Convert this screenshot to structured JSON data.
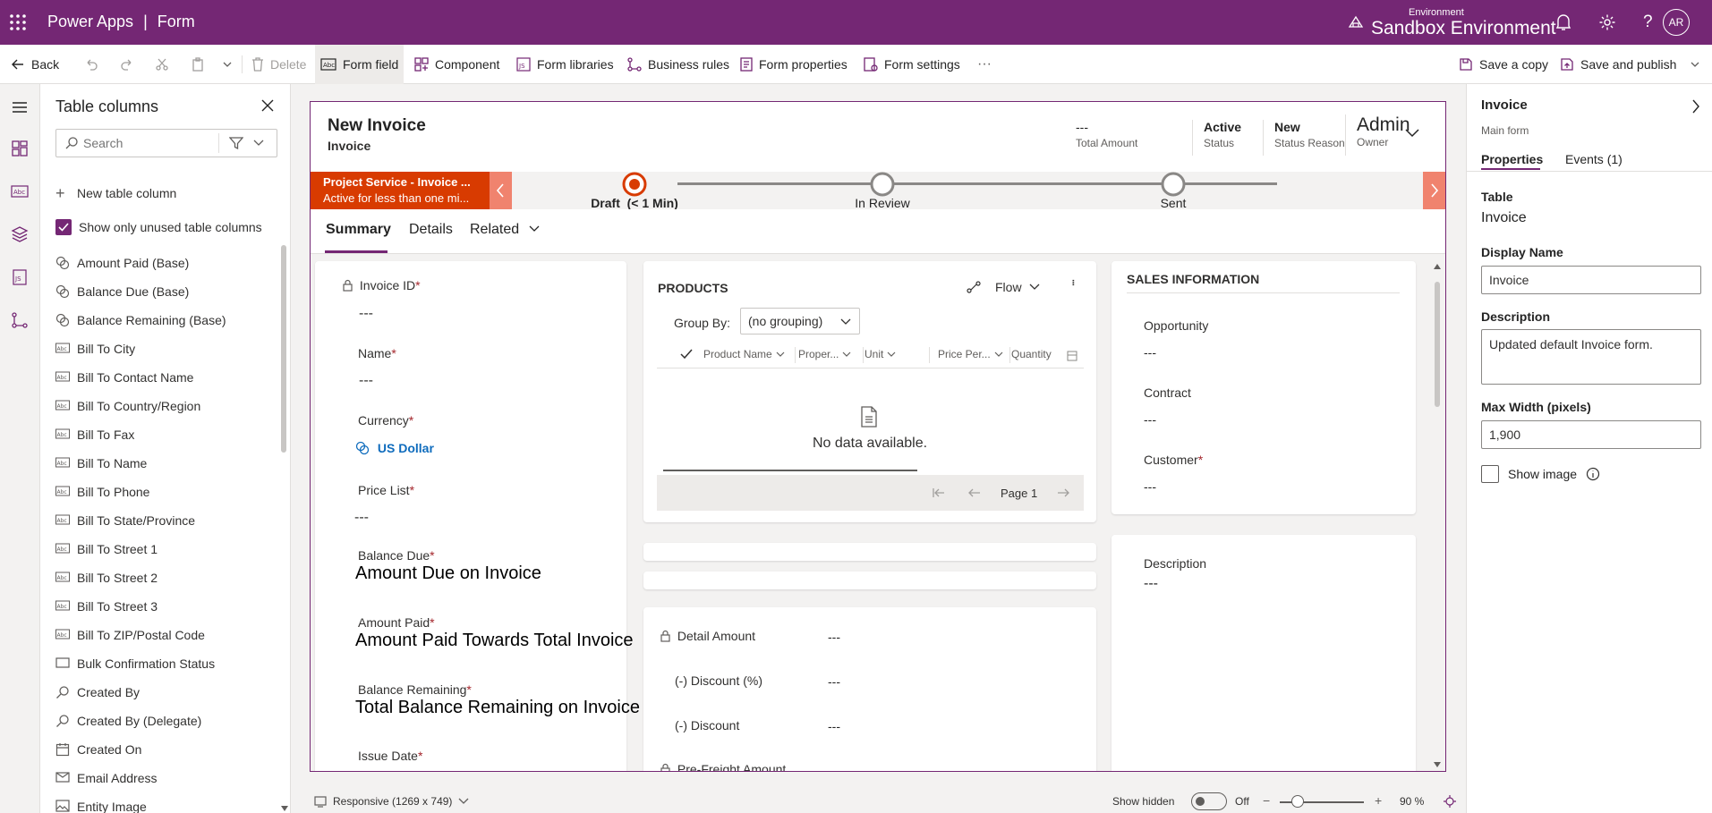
{
  "topbar": {
    "app": "Power Apps",
    "separator": "|",
    "section": "Form",
    "env_label": "Environment",
    "env_name": "Sandbox Environment",
    "avatar": "AR"
  },
  "commands": {
    "back": "Back",
    "delete": "Delete",
    "form_field": "Form field",
    "component": "Component",
    "form_libraries": "Form libraries",
    "business_rules": "Business rules",
    "form_properties": "Form properties",
    "form_settings": "Form settings",
    "more": "···",
    "save_copy": "Save a copy",
    "save_publish": "Save and publish"
  },
  "columns_panel": {
    "title": "Table columns",
    "search_placeholder": "Search",
    "new_column": "New table column",
    "show_unused": "Show only unused table columns",
    "items": [
      {
        "label": "Amount Paid (Base)",
        "icon": "currency-icon"
      },
      {
        "label": "Balance Due (Base)",
        "icon": "currency-icon"
      },
      {
        "label": "Balance Remaining (Base)",
        "icon": "currency-icon"
      },
      {
        "label": "Bill To City",
        "icon": "text-field-icon"
      },
      {
        "label": "Bill To Contact Name",
        "icon": "text-field-icon"
      },
      {
        "label": "Bill To Country/Region",
        "icon": "text-field-icon"
      },
      {
        "label": "Bill To Fax",
        "icon": "text-field-icon"
      },
      {
        "label": "Bill To Name",
        "icon": "text-field-icon"
      },
      {
        "label": "Bill To Phone",
        "icon": "text-field-icon"
      },
      {
        "label": "Bill To State/Province",
        "icon": "text-field-icon"
      },
      {
        "label": "Bill To Street 1",
        "icon": "text-field-icon"
      },
      {
        "label": "Bill To Street 2",
        "icon": "text-field-icon"
      },
      {
        "label": "Bill To Street 3",
        "icon": "text-field-icon"
      },
      {
        "label": "Bill To ZIP/Postal Code",
        "icon": "text-field-icon"
      },
      {
        "label": "Bulk Confirmation Status",
        "icon": "choice-icon"
      },
      {
        "label": "Created By",
        "icon": "lookup-icon"
      },
      {
        "label": "Created By (Delegate)",
        "icon": "lookup-icon"
      },
      {
        "label": "Created On",
        "icon": "calendar-icon"
      },
      {
        "label": "Email Address",
        "icon": "mail-icon"
      },
      {
        "label": "Entity Image",
        "icon": "image-icon"
      }
    ]
  },
  "form": {
    "title": "New Invoice",
    "subtitle": "Invoice",
    "header_fields": [
      {
        "value": "---",
        "label": "Total Amount"
      },
      {
        "value": "Active",
        "label": "Status"
      },
      {
        "value": "New",
        "label": "Status Reason"
      }
    ],
    "owner_value": "Admin",
    "owner_label": "Owner",
    "bpf": {
      "name": "Project Service - Invoice ...",
      "sub": "Active for less than one mi...",
      "stages": [
        "Draft  (< 1 Min)",
        "In Review",
        "Sent"
      ]
    },
    "tabs": [
      "Summary",
      "Details",
      "Related"
    ],
    "left_fields": {
      "invoice_id": "Invoice ID",
      "invoice_id_val": "---",
      "name": "Name",
      "name_val": "---",
      "currency": "Currency",
      "currency_val": "US Dollar",
      "price_list": "Price List",
      "price_list_val": "---",
      "balance_due": "Balance Due",
      "balance_due_val": "Amount Due on Invoice",
      "amount_paid": "Amount Paid",
      "amount_paid_val": "Amount Paid Towards Total Invoice",
      "balance_remaining": "Balance Remaining",
      "balance_remaining_val": "Total Balance Remaining on Invoice",
      "issue_date": "Issue Date",
      "asterisk": "*"
    },
    "products": {
      "title": "PRODUCTS",
      "flow": "Flow",
      "group_by": "Group By:",
      "grouping": "(no grouping)",
      "columns": [
        "Product Name",
        "Proper...",
        "Unit",
        "Price Per...",
        "Quantity"
      ],
      "empty": "No data available.",
      "page": "Page 1"
    },
    "amounts": [
      {
        "label": "Detail Amount",
        "value": "---"
      },
      {
        "label": "(-) Discount (%)",
        "value": "---"
      },
      {
        "label": "(-) Discount",
        "value": "---"
      },
      {
        "label": "Pre-Freight Amount",
        "value": ""
      }
    ],
    "sales": {
      "title": "SALES INFORMATION",
      "opportunity": "Opportunity",
      "opportunity_val": "---",
      "contract": "Contract",
      "contract_val": "---",
      "customer": "Customer",
      "customer_val": "---",
      "description": "Description",
      "description_val": "---"
    }
  },
  "properties": {
    "title": "Invoice",
    "subtitle": "Main form",
    "tab_props": "Properties",
    "tab_events": "Events (1)",
    "table_label": "Table",
    "table_value": "Invoice",
    "display_name_label": "Display Name",
    "display_name": "Invoice",
    "description_label": "Description",
    "description": "Updated default Invoice form.",
    "max_width_label": "Max Width (pixels)",
    "max_width": "1,900",
    "show_image": "Show image"
  },
  "statusbar": {
    "responsive": "Responsive (1269 x 749)",
    "show_hidden": "Show hidden",
    "toggle_state": "Off",
    "zoom": "90 %"
  },
  "colors": {
    "brand": "#742774",
    "bpf_active": "#d83b01",
    "link": "#0f6cbd"
  }
}
